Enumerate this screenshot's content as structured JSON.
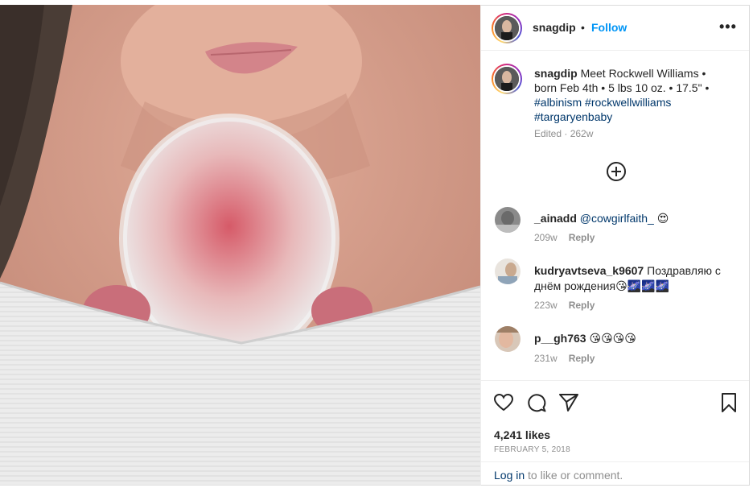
{
  "post": {
    "username": "snagdip",
    "follow_label": "Follow",
    "separator": "•",
    "more_label": "•••",
    "caption": {
      "username": "snagdip",
      "text_line1": "Meet Rockwell Williams •",
      "text_line2": "born Feb 4th • 5 lbs 10 oz. • 17.5\" •",
      "hashtags": [
        "#albinism",
        "#rockwellwilliams",
        "#targaryenbaby"
      ],
      "meta": "Edited · 262w"
    },
    "load_more_icon": "plus-circle-icon",
    "comments": [
      {
        "username": "_ainadd",
        "mention": "@cowgirlfaith_",
        "emoji": "😍",
        "age": "209w",
        "reply_label": "Reply"
      },
      {
        "username": "kudryavtseva_k9607",
        "text": "Поздравляю с днём рождения",
        "emoji": "😘🌌🌌🌌",
        "age": "223w",
        "reply_label": "Reply"
      },
      {
        "username": "p__gh763",
        "emoji": "😘😘😘😘",
        "age": "231w",
        "reply_label": "Reply"
      }
    ],
    "actions": {
      "like_icon": "heart-icon",
      "comment_icon": "comment-icon",
      "share_icon": "send-icon",
      "save_icon": "bookmark-icon"
    },
    "likes": "4,241 likes",
    "date": "FEBRUARY 5, 2018",
    "login": {
      "link": "Log in",
      "rest": " to like or comment."
    }
  },
  "colors": {
    "link_blue": "#0095f6",
    "hashtag": "#00376b",
    "muted": "#8e8e8e",
    "text": "#262626"
  }
}
